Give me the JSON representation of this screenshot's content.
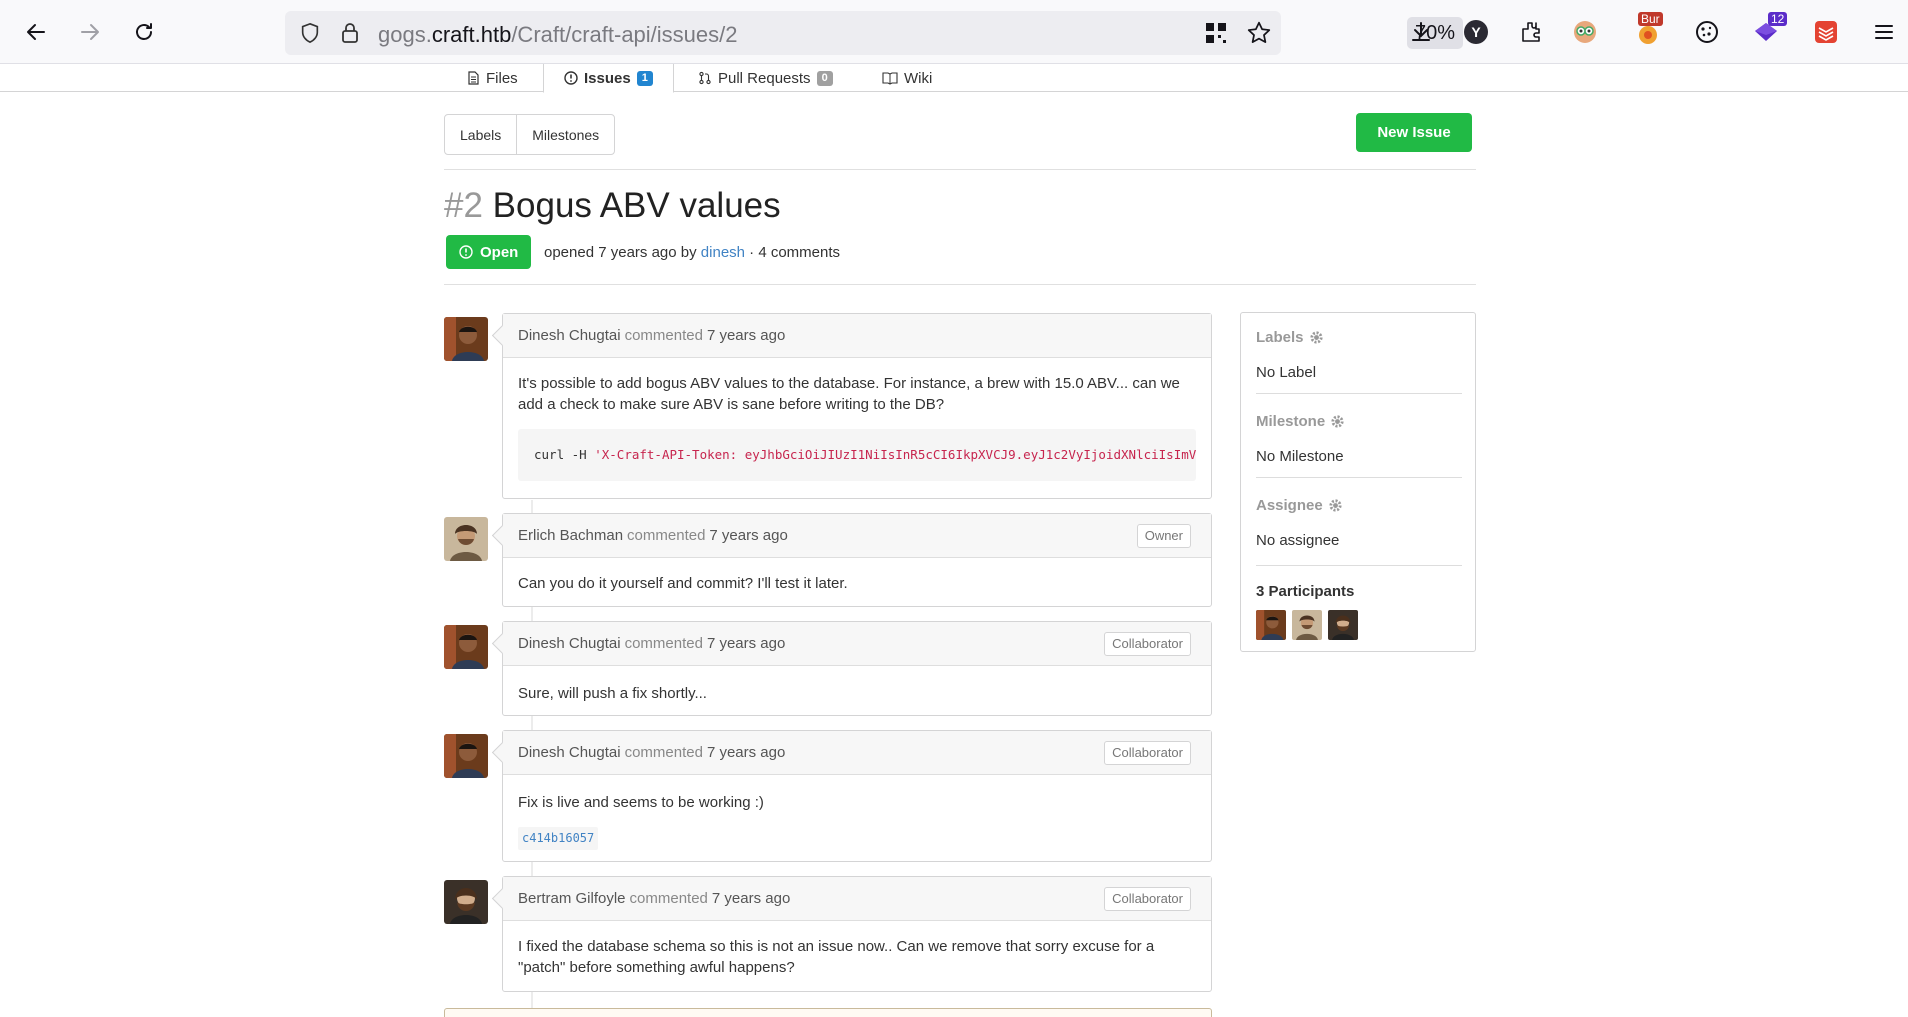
{
  "browser": {
    "url_prefix": "gogs.",
    "url_domain": "craft.htb",
    "url_path": "/Craft/craft-api/issues/2",
    "zoom": "70%",
    "ext_badge_1": "Bur",
    "ext_badge_2": "12",
    "accent": "#15141a"
  },
  "repo_tabs": [
    {
      "label": "Files",
      "icon": "file-icon"
    },
    {
      "label": "Issues",
      "icon": "issue-opened-icon",
      "count": "1"
    },
    {
      "label": "Pull Requests",
      "icon": "git-pull-request-icon",
      "count": "0"
    },
    {
      "label": "Wiki",
      "icon": "book-icon"
    }
  ],
  "issue_nav": {
    "labels": "Labels",
    "milestones": "Milestones",
    "new_issue": "New Issue"
  },
  "issue": {
    "number": "#2",
    "title": "Bogus ABV values",
    "status": "Open",
    "opened_text": "opened 7 years ago by",
    "author": "dinesh",
    "comments_text": "· 4 comments"
  },
  "comments": [
    {
      "author": "Dinesh Chugtai",
      "verb": "commented",
      "when": "7 years ago",
      "role": "",
      "body": "It's possible to add bogus ABV values to the database. For instance, a brew with 15.0 ABV... can we add a check to make sure ABV is sane before writing to the DB?",
      "code_cmd": "curl -H ",
      "code_str": "'X-Craft-API-Token: eyJhbGciOiJIUzI1NiIsInR5cCI6IkpXVCJ9.eyJ1c2VyIjoidXNlciIsImV"
    },
    {
      "author": "Erlich Bachman",
      "verb": "commented",
      "when": "7 years ago",
      "role": "Owner",
      "body": "Can you do it yourself and commit? I'll test it later."
    },
    {
      "author": "Dinesh Chugtai",
      "verb": "commented",
      "when": "7 years ago",
      "role": "Collaborator",
      "body": "Sure, will push a fix shortly..."
    },
    {
      "author": "Dinesh Chugtai",
      "verb": "commented",
      "when": "7 years ago",
      "role": "Collaborator",
      "body": "Fix is live and seems to be working :)",
      "commit": "c414b16057"
    },
    {
      "author": "Bertram Gilfoyle",
      "verb": "commented",
      "when": "7 years ago",
      "role": "Collaborator",
      "body": "I fixed the database schema so this is not an issue now.. Can we remove that sorry excuse for a \"patch\" before something awful happens?"
    }
  ],
  "sidebar": {
    "labels_title": "Labels",
    "labels_value": "No Label",
    "milestone_title": "Milestone",
    "milestone_value": "No Milestone",
    "assignee_title": "Assignee",
    "assignee_value": "No assignee",
    "participants_title": "3 Participants"
  },
  "colors": {
    "green": "#21ba45",
    "link": "#4183c4",
    "issues_count": "#2185d0",
    "pr_count": "#a0a0a0"
  }
}
